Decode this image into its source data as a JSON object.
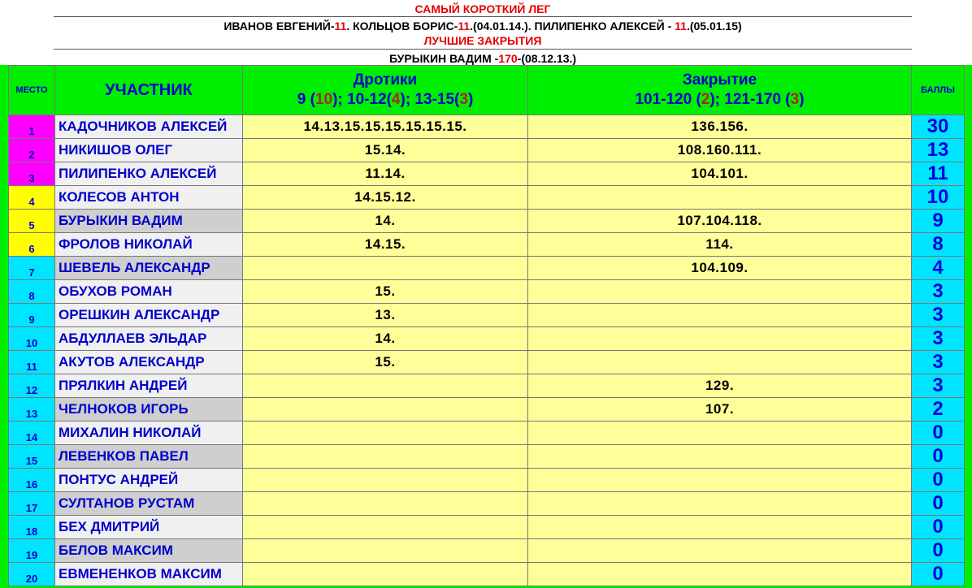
{
  "header": {
    "shortest_leg_title": "САМЫЙ КОРОТКИЙ ЛЕГ",
    "shortest_leg_parts": [
      {
        "text": "ИВАНОВ ЕВГЕНИЙ-",
        "color": "black"
      },
      {
        "text": "11",
        "color": "red"
      },
      {
        "text": ". КОЛЬЦОВ БОРИС-",
        "color": "black"
      },
      {
        "text": "11",
        "color": "red"
      },
      {
        "text": ".(04.01.14.). ПИЛИПЕНКО АЛЕКСЕЙ - ",
        "color": "black"
      },
      {
        "text": "11",
        "color": "red"
      },
      {
        "text": ".(05.01.15)",
        "color": "black"
      }
    ],
    "best_closings_title": "ЛУЧШИЕ ЗАКРЫТИЯ",
    "best_closings_parts": [
      {
        "text": "БУРЫКИН ВАДИМ -",
        "color": "black"
      },
      {
        "text": "170",
        "color": "red"
      },
      {
        "text": "-(08.12.13.)",
        "color": "black"
      }
    ]
  },
  "table": {
    "col_place": "МЕСТО",
    "col_name": "УЧАСТНИК",
    "col_darts_title": "Дротики",
    "col_darts_sub": [
      {
        "text": "9 (",
        "color": "normal"
      },
      {
        "text": "10",
        "color": "ck"
      },
      {
        "text": "); 10-12(",
        "color": "normal"
      },
      {
        "text": "4",
        "color": "ck"
      },
      {
        "text": "); 13-15(",
        "color": "normal"
      },
      {
        "text": "3",
        "color": "ck"
      },
      {
        "text": ")",
        "color": "normal"
      }
    ],
    "col_close_title": "Закрытие",
    "col_close_sub": [
      {
        "text": "101-120 (",
        "color": "normal"
      },
      {
        "text": "2",
        "color": "ck"
      },
      {
        "text": "); 121-170 (",
        "color": "normal"
      },
      {
        "text": "3",
        "color": "ck"
      },
      {
        "text": ")",
        "color": "normal"
      }
    ],
    "col_points": "БАЛЛЫ"
  },
  "colors": {
    "background_green": "#00ee00",
    "place_top3": "#ff00ff",
    "place_4_6": "#ffff00",
    "place_rest": "#00e5ff",
    "cell_yellow": "#ffff99",
    "points_cyan": "#00e5ff"
  },
  "rows": [
    {
      "place": "1",
      "name": "КАДОЧНИКОВ АЛЕКСЕЙ",
      "darts": "14.13.15.15.15.15.15.15.",
      "close": "136.156.",
      "points": "30",
      "tier": "top",
      "shade": "light"
    },
    {
      "place": "2",
      "name": "НИКИШОВ ОЛЕГ",
      "darts": "15.14.",
      "close": "108.160.111.",
      "points": "13",
      "tier": "top",
      "shade": "light"
    },
    {
      "place": "3",
      "name": "ПИЛИПЕНКО АЛЕКСЕЙ",
      "darts": "11.14.",
      "close": "104.101.",
      "points": "11",
      "tier": "top",
      "shade": "light"
    },
    {
      "place": "4",
      "name": "КОЛЕСОВ АНТОН",
      "darts": "14.15.12.",
      "close": "",
      "points": "10",
      "tier": "mid",
      "shade": "light"
    },
    {
      "place": "5",
      "name": "БУРЫКИН ВАДИМ",
      "darts": "14.",
      "close": "107.104.118.",
      "points": "9",
      "tier": "mid",
      "shade": "dark"
    },
    {
      "place": "6",
      "name": "ФРОЛОВ НИКОЛАЙ",
      "darts": "14.15.",
      "close": "114.",
      "points": "8",
      "tier": "mid",
      "shade": "light"
    },
    {
      "place": "7",
      "name": "ШЕВЕЛЬ АЛЕКСАНДР",
      "darts": "",
      "close": "104.109.",
      "points": "4",
      "tier": "rest",
      "shade": "dark"
    },
    {
      "place": "8",
      "name": "ОБУХОВ РОМАН",
      "darts": "15.",
      "close": "",
      "points": "3",
      "tier": "rest",
      "shade": "light"
    },
    {
      "place": "9",
      "name": "ОРЕШКИН АЛЕКСАНДР",
      "darts": "13.",
      "close": "",
      "points": "3",
      "tier": "rest",
      "shade": "light"
    },
    {
      "place": "10",
      "name": "АБДУЛЛАЕВ ЭЛЬДАР",
      "darts": "14.",
      "close": "",
      "points": "3",
      "tier": "rest",
      "shade": "light"
    },
    {
      "place": "11",
      "name": "АКУТОВ АЛЕКСАНДР",
      "darts": "15.",
      "close": "",
      "points": "3",
      "tier": "rest",
      "shade": "light"
    },
    {
      "place": "12",
      "name": "ПРЯЛКИН АНДРЕЙ",
      "darts": "",
      "close": "129.",
      "points": "3",
      "tier": "rest",
      "shade": "light"
    },
    {
      "place": "13",
      "name": "ЧЕЛНОКОВ ИГОРЬ",
      "darts": "",
      "close": "107.",
      "points": "2",
      "tier": "rest",
      "shade": "dark"
    },
    {
      "place": "14",
      "name": "МИХАЛИН НИКОЛАЙ",
      "darts": "",
      "close": "",
      "points": "0",
      "tier": "rest",
      "shade": "light"
    },
    {
      "place": "15",
      "name": "ЛЕВЕНКОВ ПАВЕЛ",
      "darts": "",
      "close": "",
      "points": "0",
      "tier": "rest",
      "shade": "dark"
    },
    {
      "place": "16",
      "name": "ПОНТУС АНДРЕЙ",
      "darts": "",
      "close": "",
      "points": "0",
      "tier": "rest",
      "shade": "light"
    },
    {
      "place": "17",
      "name": "СУЛТАНОВ РУСТАМ",
      "darts": "",
      "close": "",
      "points": "0",
      "tier": "rest",
      "shade": "dark"
    },
    {
      "place": "18",
      "name": "БЕХ ДМИТРИЙ",
      "darts": "",
      "close": "",
      "points": "0",
      "tier": "rest",
      "shade": "light"
    },
    {
      "place": "19",
      "name": "БЕЛОВ МАКСИМ",
      "darts": "",
      "close": "",
      "points": "0",
      "tier": "rest",
      "shade": "dark"
    },
    {
      "place": "20",
      "name": "ЕВМЕНЕНКОВ МАКСИМ",
      "darts": "",
      "close": "",
      "points": "0",
      "tier": "rest",
      "shade": "light"
    }
  ]
}
